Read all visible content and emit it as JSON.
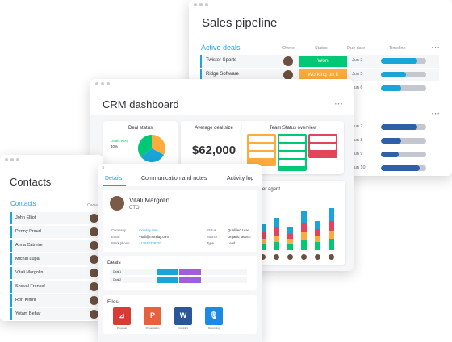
{
  "sales": {
    "title": "Sales pipeline",
    "group": "Active deals",
    "headers": {
      "owner": "Owner",
      "status": "Status",
      "due": "Due date",
      "timeline": "Timeline"
    },
    "rows": [
      {
        "name": "Twister Sports",
        "status": "Won",
        "status_color": "#00c875",
        "due": "Jun 2",
        "progress": 0.8,
        "bar_color": "#1aa5d8"
      },
      {
        "name": "Ridge Software",
        "status": "Working on it",
        "status_color": "#fdab3d",
        "due": "Jun 5",
        "progress": 0.55,
        "bar_color": "#1aa5d8"
      },
      {
        "name": "",
        "status": "",
        "status_color": "#fdab3d",
        "due": "Jun 6",
        "progress": 0.45,
        "bar_color": "#1aa5d8"
      },
      {
        "name": "",
        "status": "",
        "status_color": "#fdab3d",
        "due": "Jun 7",
        "progress": 0.8,
        "bar_color": "#2f5fa6"
      },
      {
        "name": "",
        "status": "",
        "status_color": "#fdab3d",
        "due": "Jun 8",
        "progress": 0.45,
        "bar_color": "#2f5fa6"
      },
      {
        "name": "",
        "status": "",
        "status_color": "#fdab3d",
        "due": "Jun 9",
        "progress": 0.4,
        "bar_color": "#2f5fa6"
      },
      {
        "name": "",
        "status": "",
        "status_color": "#fdab3d",
        "due": "Jun 10",
        "progress": 0.85,
        "bar_color": "#2f5fa6"
      }
    ],
    "more": "•••"
  },
  "crm": {
    "title": "CRM dashboard",
    "deal_status": {
      "title": "Deal status",
      "legend_label": "Deals won",
      "legend_value": "40%"
    },
    "avg_deal": {
      "title": "Average deal size",
      "value": "$62,000"
    },
    "team_status": {
      "title": "Team Status overview"
    },
    "per_agent": {
      "title": "ss per agent"
    },
    "more": "•••"
  },
  "contacts": {
    "title": "Contacts",
    "group": "Contacts",
    "header": "Owner",
    "items": [
      "John Elliot",
      "Penny Proud",
      "Anna Catmire",
      "Michal Lupa",
      "Vitali Margolin",
      "Shoval Frenkel",
      "Ron Kimhi",
      "Yotam Behar"
    ]
  },
  "detail": {
    "close": "×",
    "tabs": [
      "Details",
      "Communication and notes",
      "Activity log"
    ],
    "person": {
      "name": "Vitali Margolin",
      "role": "CTO"
    },
    "fields_left": [
      {
        "label": "Company",
        "value": "monday.com"
      },
      {
        "label": "Email",
        "value": "Vitali@monday.com"
      },
      {
        "label": "Work phone",
        "value": "+17542326232"
      }
    ],
    "fields_right": [
      {
        "label": "Status",
        "value": "Qualified Lead"
      },
      {
        "label": "Source",
        "value": "Organic search"
      },
      {
        "label": "Type",
        "value": "Lead"
      }
    ],
    "deals": {
      "title": "Deals",
      "rows": [
        {
          "name": "Deal 1",
          "s1": "",
          "s1_color": "#1aa5d8",
          "s2": "",
          "s2_color": "#a25ddc",
          "v": "",
          "v2": ""
        },
        {
          "name": "Deal 2",
          "s1": "",
          "s1_color": "#1aa5d8",
          "s2": "",
          "s2_color": "#a25ddc",
          "v": "",
          "v2": ""
        }
      ]
    },
    "files": {
      "title": "Files",
      "items": [
        {
          "glyph": "⊿",
          "color": "#d83a34",
          "caption": "Proposal"
        },
        {
          "glyph": "P",
          "color": "#e8613c",
          "caption": "Presentation"
        },
        {
          "glyph": "W",
          "color": "#2b579a",
          "caption": "Contract"
        },
        {
          "glyph": "🎙",
          "color": "#1e88e5",
          "caption": "Recording"
        }
      ]
    }
  }
}
